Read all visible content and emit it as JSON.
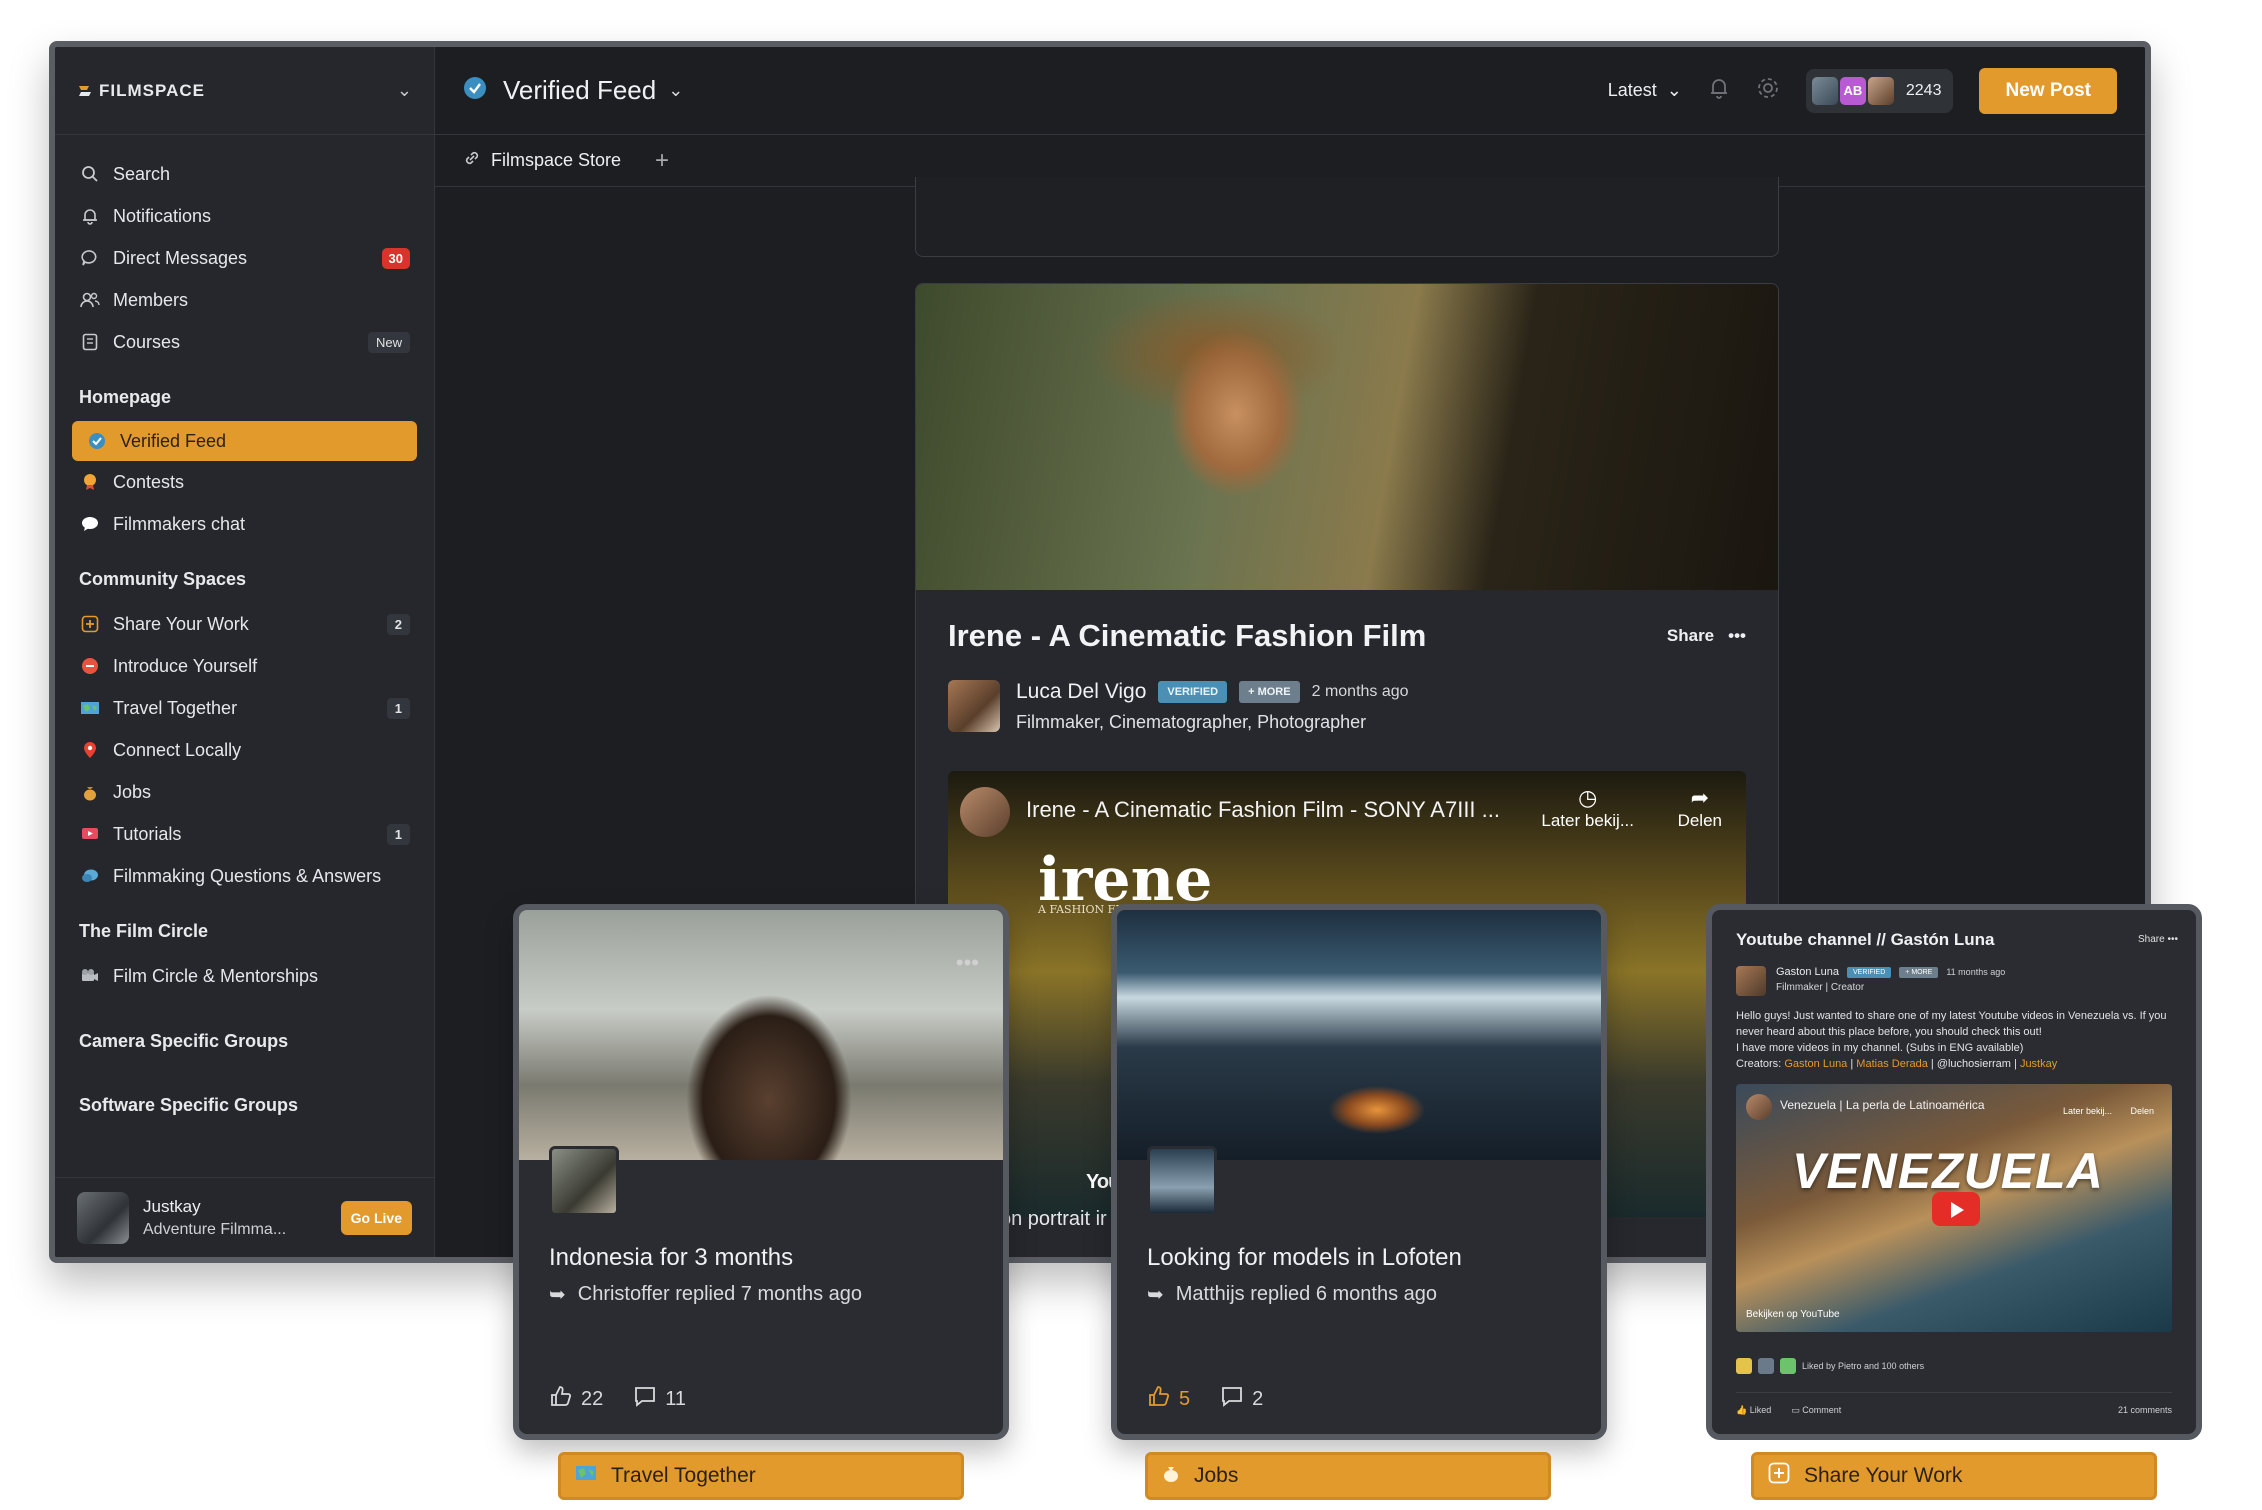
{
  "app": {
    "brand": "FILMSPACE",
    "feed_title": "Verified Feed",
    "sort_label": "Latest",
    "member_initials": "AB",
    "member_count": "2243",
    "new_post_label": "New Post",
    "subnav_link": "Filmspace Store",
    "accent": "#e39a2d"
  },
  "sidebar": {
    "primary": [
      {
        "label": "Search",
        "icon": "search-icon"
      },
      {
        "label": "Notifications",
        "icon": "bell-icon"
      },
      {
        "label": "Direct Messages",
        "icon": "chat-icon",
        "badge": "30"
      },
      {
        "label": "Members",
        "icon": "members-icon"
      },
      {
        "label": "Courses",
        "icon": "book-icon",
        "badge": "New"
      }
    ],
    "homepage_title": "Homepage",
    "homepage": [
      {
        "label": "Verified Feed",
        "icon": "verified-icon"
      },
      {
        "label": "Contests",
        "icon": "trophy-icon"
      },
      {
        "label": "Filmmakers chat",
        "icon": "speech-bubble-icon"
      }
    ],
    "community_title": "Community Spaces",
    "community": [
      {
        "label": "Share Your Work",
        "icon": "plus-square-icon",
        "badge": "2"
      },
      {
        "label": "Introduce Yourself",
        "icon": "wave-icon"
      },
      {
        "label": "Travel Together",
        "icon": "map-icon",
        "badge": "1"
      },
      {
        "label": "Connect Locally",
        "icon": "pin-icon"
      },
      {
        "label": "Jobs",
        "icon": "money-bag-icon"
      },
      {
        "label": "Tutorials",
        "icon": "video-icon",
        "badge": "1"
      },
      {
        "label": "Filmmaking Questions & Answers",
        "icon": "question-icon"
      }
    ],
    "film_circle_title": "The Film Circle",
    "film_circle": [
      {
        "label": "Film Circle & Mentorships",
        "icon": "camera-icon"
      }
    ],
    "camera_title": "Camera Specific Groups",
    "software_title": "Software Specific Groups",
    "user": {
      "name": "Justkay",
      "subtitle": "Adventure Filmma...",
      "go_live": "Go Live"
    }
  },
  "post": {
    "title": "Irene - A Cinematic Fashion Film",
    "share_label": "Share",
    "author": "Luca Del Vigo",
    "verified_label": "VERIFIED",
    "more_label": "+ MORE",
    "time": "2 months ago",
    "role": "Filmmaker, Cinematographer, Photographer",
    "video": {
      "title": "Irene - A Cinematic Fashion Film - SONY A7III ...",
      "later": "Later bekij...",
      "share": "Delen",
      "logo_text": "irene",
      "logo_sub": "A FASHION FILM BY LDVFILMS",
      "youtube": "YouTube"
    },
    "caption_fragment": "on portrait ir"
  },
  "cards": [
    {
      "title": "Indonesia for 3 months",
      "reply": "Christoffer replied 7 months ago",
      "likes": "22",
      "comments": "11",
      "tag": "Travel Together"
    },
    {
      "title": "Looking for models in Lofoten",
      "reply": "Matthijs replied 6 months ago",
      "likes": "5",
      "comments": "2",
      "tag": "Jobs"
    }
  ],
  "youtube_card": {
    "title": "Youtube channel // Gastón Luna",
    "share": "Share",
    "author": "Gaston Luna",
    "verified": "VERIFIED",
    "more": "+ MORE",
    "time": "11 months ago",
    "role": "Filmmaker | Creator",
    "text_1": "Hello guys! Just wanted to share one of my latest Youtube videos in Venezuela vs. If you never heard about this place before, you should check this out!",
    "text_2": "I have more videos in my channel. (Subs in ENG available)",
    "creators_label": "Creators:",
    "creator_1": "Gaston Luna",
    "creator_2": "Matias Derada",
    "creator_3": "| @luchosierram |",
    "creator_4": "Justkay",
    "video_title": "Venezuela | La perla de Latinoamérica",
    "video_big": "VENEZUELA",
    "video_later": "Later bekij...",
    "video_share": "Delen",
    "video_watch": "Bekijken op  YouTube",
    "liked_by": "Liked by Pietro and 100 others",
    "liked": "Liked",
    "comment": "Comment",
    "comments_count": "21 comments",
    "tag": "Share Your Work"
  }
}
